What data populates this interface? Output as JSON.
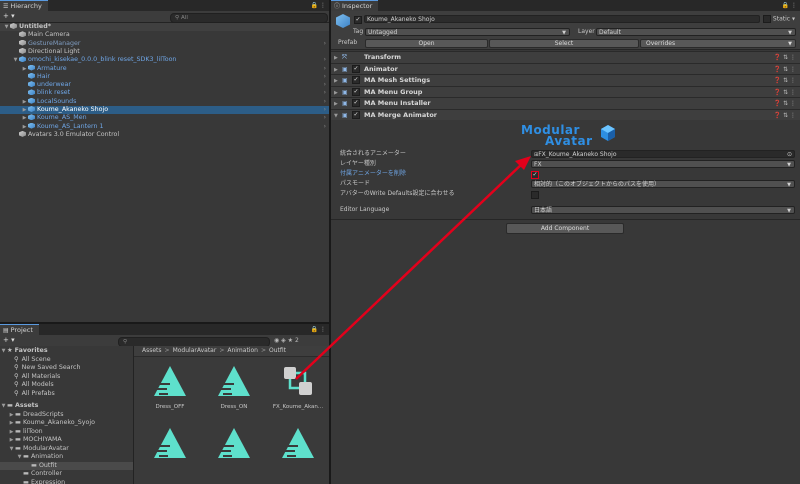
{
  "hierarchy": {
    "tab": "Hierarchy",
    "search_placeholder": "All",
    "add_label": "+ ▾",
    "items": [
      {
        "label": "Untitled*",
        "indent": 0,
        "arrow": "▼",
        "icon": "unity",
        "style": "scene"
      },
      {
        "label": "Main Camera",
        "indent": 1,
        "arrow": "",
        "icon": "cube",
        "style": ""
      },
      {
        "label": "GestureManager",
        "indent": 1,
        "arrow": "",
        "icon": "cube",
        "style": "grey"
      },
      {
        "label": "Directional Light",
        "indent": 1,
        "arrow": "",
        "icon": "cube",
        "style": ""
      },
      {
        "label": "omochi_kisekae_0.0.0_blink reset_SDK3_lilToon",
        "indent": 1,
        "arrow": "▼",
        "icon": "pcube",
        "style": "blue"
      },
      {
        "label": "Armature",
        "indent": 2,
        "arrow": "▶",
        "icon": "pcube",
        "style": "blue"
      },
      {
        "label": "Hair",
        "indent": 2,
        "arrow": "",
        "icon": "pcube",
        "style": "blue"
      },
      {
        "label": "underwear",
        "indent": 2,
        "arrow": "",
        "icon": "pcube",
        "style": "blue"
      },
      {
        "label": "blink reset",
        "indent": 2,
        "arrow": "",
        "icon": "pcube",
        "style": "blue"
      },
      {
        "label": "LocalSounds",
        "indent": 2,
        "arrow": "▶",
        "icon": "pcube",
        "style": "blue"
      },
      {
        "label": "Koume_Akaneko Shojo",
        "indent": 2,
        "arrow": "▶",
        "icon": "pcube",
        "style": "selected"
      },
      {
        "label": "Koume_AS_Men",
        "indent": 2,
        "arrow": "▶",
        "icon": "pcube",
        "style": "blue"
      },
      {
        "label": "Koume_AS_Lantern 1",
        "indent": 2,
        "arrow": "▶",
        "icon": "pcube",
        "style": "blue"
      },
      {
        "label": "Avatars 3.0 Emulator Control",
        "indent": 1,
        "arrow": "",
        "icon": "cube",
        "style": ""
      }
    ]
  },
  "project": {
    "tab": "Project",
    "add_label": "+ ▾",
    "count_badge": "2",
    "favorites_label": "Favorites",
    "favorites": [
      "All Scene",
      "New Saved Search",
      "All Materials",
      "All Models",
      "All Prefabs"
    ],
    "assets_label": "Assets",
    "tree": [
      {
        "label": "DreadScripts",
        "indent": 1,
        "arrow": "▶"
      },
      {
        "label": "Koume_Akaneko_Syojo",
        "indent": 1,
        "arrow": "▶"
      },
      {
        "label": "lilToon",
        "indent": 1,
        "arrow": "▶"
      },
      {
        "label": "MOCHIYAMA",
        "indent": 1,
        "arrow": "▶"
      },
      {
        "label": "ModularAvatar",
        "indent": 1,
        "arrow": "▼"
      },
      {
        "label": "Animation",
        "indent": 2,
        "arrow": "▼"
      },
      {
        "label": "Outfit",
        "indent": 3,
        "arrow": ""
      },
      {
        "label": "Controller",
        "indent": 2,
        "arrow": ""
      },
      {
        "label": "Expression",
        "indent": 2,
        "arrow": ""
      }
    ],
    "breadcrumb": [
      "Assets",
      "ModularAvatar",
      "Animation",
      "Outfit"
    ],
    "breadcrumb_sep": ">",
    "assets": [
      {
        "name": "Dress_OFF",
        "type": "clip"
      },
      {
        "name": "Dress_ON",
        "type": "clip"
      },
      {
        "name": "FX_Koume_Akan...",
        "type": "controller"
      },
      {
        "name": "",
        "type": "clip"
      },
      {
        "name": "",
        "type": "clip"
      },
      {
        "name": "",
        "type": "clip"
      }
    ]
  },
  "inspector": {
    "tab": "Inspector",
    "object_name": "Koume_Akaneko Shojo",
    "static_label": "Static",
    "tag_label": "Tag",
    "tag_value": "Untagged",
    "layer_label": "Layer",
    "layer_value": "Default",
    "prefab_label": "Prefab",
    "prefab_open": "Open",
    "prefab_select": "Select",
    "prefab_overrides": "Overrides",
    "components": [
      {
        "name": "Transform",
        "checkbox": false
      },
      {
        "name": "Animator",
        "checkbox": true
      },
      {
        "name": "MA Mesh Settings",
        "checkbox": true
      },
      {
        "name": "MA Menu Group",
        "checkbox": true
      },
      {
        "name": "MA Menu Installer",
        "checkbox": true
      },
      {
        "name": "MA Merge Animator",
        "checkbox": true
      }
    ],
    "logo_line1": "Modular",
    "logo_line2": "Avatar",
    "merge_fields": {
      "animator_label": "統合されるアニメーター",
      "animator_value": "FX_Koume_Akaneko Shojo",
      "layer_type_label": "レイヤー種別",
      "layer_type_value": "FX",
      "delete_attached_label": "付属アニメーターを削除",
      "delete_attached_checked": "✓",
      "path_mode_label": "パスモード",
      "path_mode_value": "相対的（このオブジェクトからのパスを使用）",
      "write_defaults_label": "アバターのWrite Defaults設定に合わせる",
      "editor_language_label": "Editor Language",
      "editor_language_value": "日本語"
    },
    "add_component": "Add Component"
  },
  "colors": {
    "selection": "#2c5d87",
    "accent_blue": "#6fa6e6",
    "teal": "#5ee0cc",
    "arrow_red": "#e3001b"
  }
}
